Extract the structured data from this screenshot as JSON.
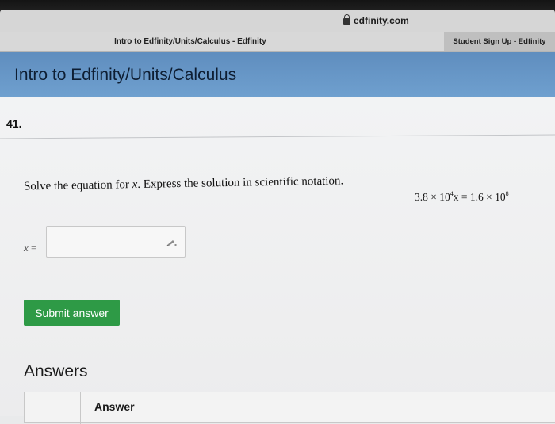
{
  "browser": {
    "domain": "edfinity.com",
    "active_tab": "Intro to Edfinity/Units/Calculus - Edfinity",
    "other_tab": "Student Sign Up - Edfinity"
  },
  "header": {
    "title": "Intro to Edfinity/Units/Calculus"
  },
  "question": {
    "number": "41.",
    "prompt_before": "Solve the equation for ",
    "prompt_var": "x",
    "prompt_after": ". Express the solution in scientific notation.",
    "equation": {
      "left_coef": "3.8 × 10",
      "left_exp": "4",
      "left_var": "x = 1.6 × 10",
      "right_exp": "8"
    },
    "input_label_var": "x",
    "input_label_eq": " =",
    "input_value": ""
  },
  "actions": {
    "submit_label": "Submit answer"
  },
  "answers": {
    "heading": "Answers",
    "column_header": "Answer"
  },
  "colors": {
    "header_blue": "#6a9ac9",
    "submit_green": "#2e9a46"
  },
  "icons": {
    "lock": "lock-icon",
    "edit": "pencil-icon"
  }
}
